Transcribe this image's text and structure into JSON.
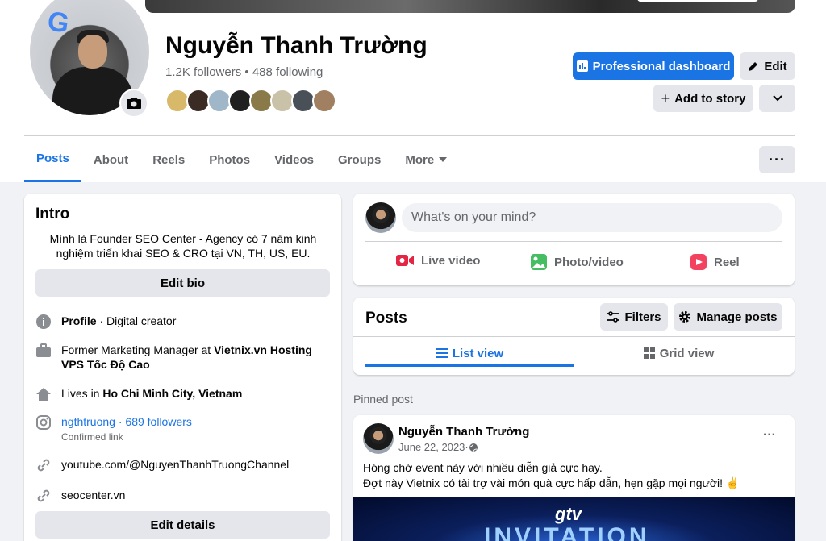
{
  "profile": {
    "name": "Nguyễn Thanh Trường",
    "followers": "1.2K followers",
    "separator": "•",
    "following": "488 following"
  },
  "header_buttons": {
    "professional_dashboard": "Professional dashboard",
    "edit": "Edit",
    "add_to_story": "Add to story"
  },
  "tabs": [
    "Posts",
    "About",
    "Reels",
    "Photos",
    "Videos",
    "Groups",
    "More"
  ],
  "intro": {
    "title": "Intro",
    "bio": "Mình là Founder SEO Center - Agency có 7 năm kinh nghiệm triển khai SEO & CRO tại VN, TH, US, EU.",
    "edit_bio": "Edit bio",
    "profile_label": "Profile",
    "profile_value": " · Digital creator",
    "work_prefix": "Former Marketing Manager at ",
    "work_company": "Vietnix.vn Hosting VPS Tốc Độ Cao",
    "lives_prefix": "Lives in ",
    "lives_city": "Ho Chi Minh City, Vietnam",
    "instagram_handle": "ngthtruong",
    "instagram_sep": " · ",
    "instagram_followers": "689 followers",
    "instagram_sub": "Confirmed link",
    "youtube": "youtube.com/@NguyenThanhTruongChannel",
    "website": "seocenter.vn",
    "edit_details": "Edit details"
  },
  "composer": {
    "placeholder": "What's on your mind?",
    "live_video": "Live video",
    "photo_video": "Photo/video",
    "reel": "Reel"
  },
  "posts_card": {
    "title": "Posts",
    "filters": "Filters",
    "manage_posts": "Manage posts",
    "list_view": "List view",
    "grid_view": "Grid view"
  },
  "pinned": {
    "label": "Pinned post",
    "author": "Nguyễn Thanh Trường",
    "date": "June 22, 2023",
    "date_sep": " · ",
    "line1": "Hóng chờ event này với nhiều diễn giả cực hay.",
    "line2": "Đợt này Vietnix có tài trợ vài món quà cực hấp dẫn, hẹn gặp mọi người! ✌️",
    "image_text1": "gtv",
    "image_text2": "INVITATION"
  },
  "colors": {
    "accent": "#1b74e4",
    "text_secondary": "#65676b",
    "button_grey": "#e4e6eb",
    "background": "#f0f2f5"
  }
}
